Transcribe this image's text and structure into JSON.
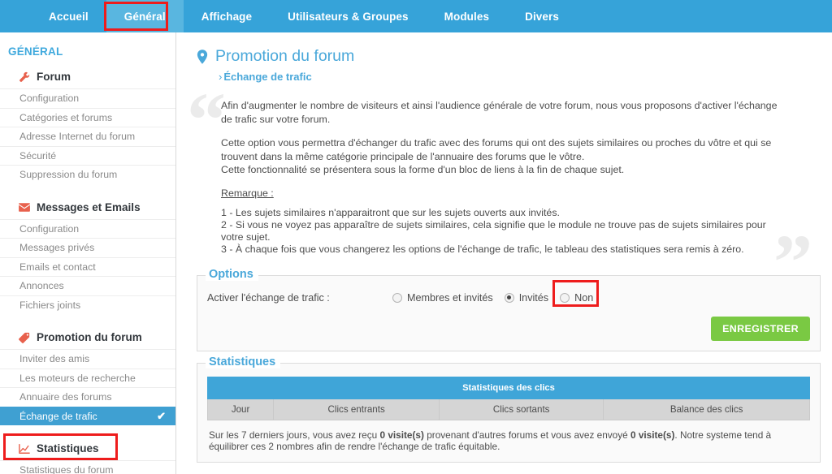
{
  "topnav": {
    "items": [
      {
        "label": "Accueil",
        "active": false
      },
      {
        "label": "Général",
        "active": true
      },
      {
        "label": "Affichage",
        "active": false
      },
      {
        "label": "Utilisateurs & Groupes",
        "active": false
      },
      {
        "label": "Modules",
        "active": false
      },
      {
        "label": "Divers",
        "active": false
      }
    ],
    "highlight_color": "#ee1c1c",
    "bar_color": "#36a3d9",
    "active_color": "#59b6e0"
  },
  "sidebar": {
    "section_title": "GÉNÉRAL",
    "groups": [
      {
        "title": "Forum",
        "icon": "wrench-icon",
        "links": [
          {
            "label": "Configuration",
            "active": false
          },
          {
            "label": "Catégories et forums",
            "active": false
          },
          {
            "label": "Adresse Internet du forum",
            "active": false
          },
          {
            "label": "Sécurité",
            "active": false
          },
          {
            "label": "Suppression du forum",
            "active": false
          }
        ]
      },
      {
        "title": "Messages et Emails",
        "icon": "envelope-icon",
        "links": [
          {
            "label": "Configuration",
            "active": false
          },
          {
            "label": "Messages privés",
            "active": false
          },
          {
            "label": "Emails et contact",
            "active": false
          },
          {
            "label": "Annonces",
            "active": false
          },
          {
            "label": "Fichiers joints",
            "active": false
          }
        ]
      },
      {
        "title": "Promotion du forum",
        "icon": "tag-icon",
        "links": [
          {
            "label": "Inviter des amis",
            "active": false
          },
          {
            "label": "Les moteurs de recherche",
            "active": false
          },
          {
            "label": "Annuaire des forums",
            "active": false
          },
          {
            "label": "Échange de trafic",
            "active": true,
            "check": "✔"
          }
        ]
      },
      {
        "title": "Statistiques",
        "icon": "chart-icon",
        "links": [
          {
            "label": "Statistiques du forum",
            "active": false
          }
        ]
      }
    ]
  },
  "page": {
    "title": "Promotion du forum",
    "title_icon": "map-pin-icon",
    "breadcrumb_chevron": "›",
    "breadcrumb": "Échange de trafic"
  },
  "intro": {
    "quote_open": "“",
    "quote_close": "”",
    "paragraph1": "Afin d'augmenter le nombre de visiteurs et ainsi l'audience générale de votre forum, nous vous proposons d'activer l'échange de trafic sur votre forum.",
    "paragraph2": "Cette option vous permettra d'échanger du trafic avec des forums qui ont des sujets similaires ou proches du vôtre et qui se trouvent dans la même catégorie principale de l'annuaire des forums que le vôtre.",
    "paragraph3": "Cette fonctionnalité se présentera sous la forme d'un bloc de liens à la fin de chaque sujet.",
    "remark_title": "Remarque :",
    "remarks": [
      "1 - Les sujets similaires n'apparaitront que sur les sujets ouverts aux invités.",
      "2 - Si vous ne voyez pas apparaître de sujets similaires, cela signifie que le module ne trouve pas de sujets similaires pour votre sujet.",
      "3 - À chaque fois que vous changerez les options de l'échange de trafic, le tableau des statistiques sera remis à zéro."
    ]
  },
  "options": {
    "legend": "Options",
    "field_label": "Activer l'échange de trafic :",
    "radios": [
      {
        "label": "Membres et invités",
        "selected": false
      },
      {
        "label": "Invités",
        "selected": true
      },
      {
        "label": "Non",
        "selected": false
      }
    ],
    "highlighted_radio": "Non",
    "save_label": "ENREGISTRER",
    "save_color": "#7ac943"
  },
  "statistics": {
    "legend": "Statistiques",
    "table": {
      "main_header": "Statistiques des clics",
      "columns": [
        "Jour",
        "Clics entrants",
        "Clics sortants",
        "Balance des clics"
      ],
      "rows": []
    },
    "note_part1": "Sur les 7 derniers jours, vous avez reçu ",
    "note_value1": "0 visite(s)",
    "note_part2": " provenant d'autres forums et vous avez envoyé ",
    "note_value2": "0 visite(s)",
    "note_part3": ". Notre systeme tend à équilibrer ces 2 nombres afin de rendre l'échange de trafic équitable."
  }
}
